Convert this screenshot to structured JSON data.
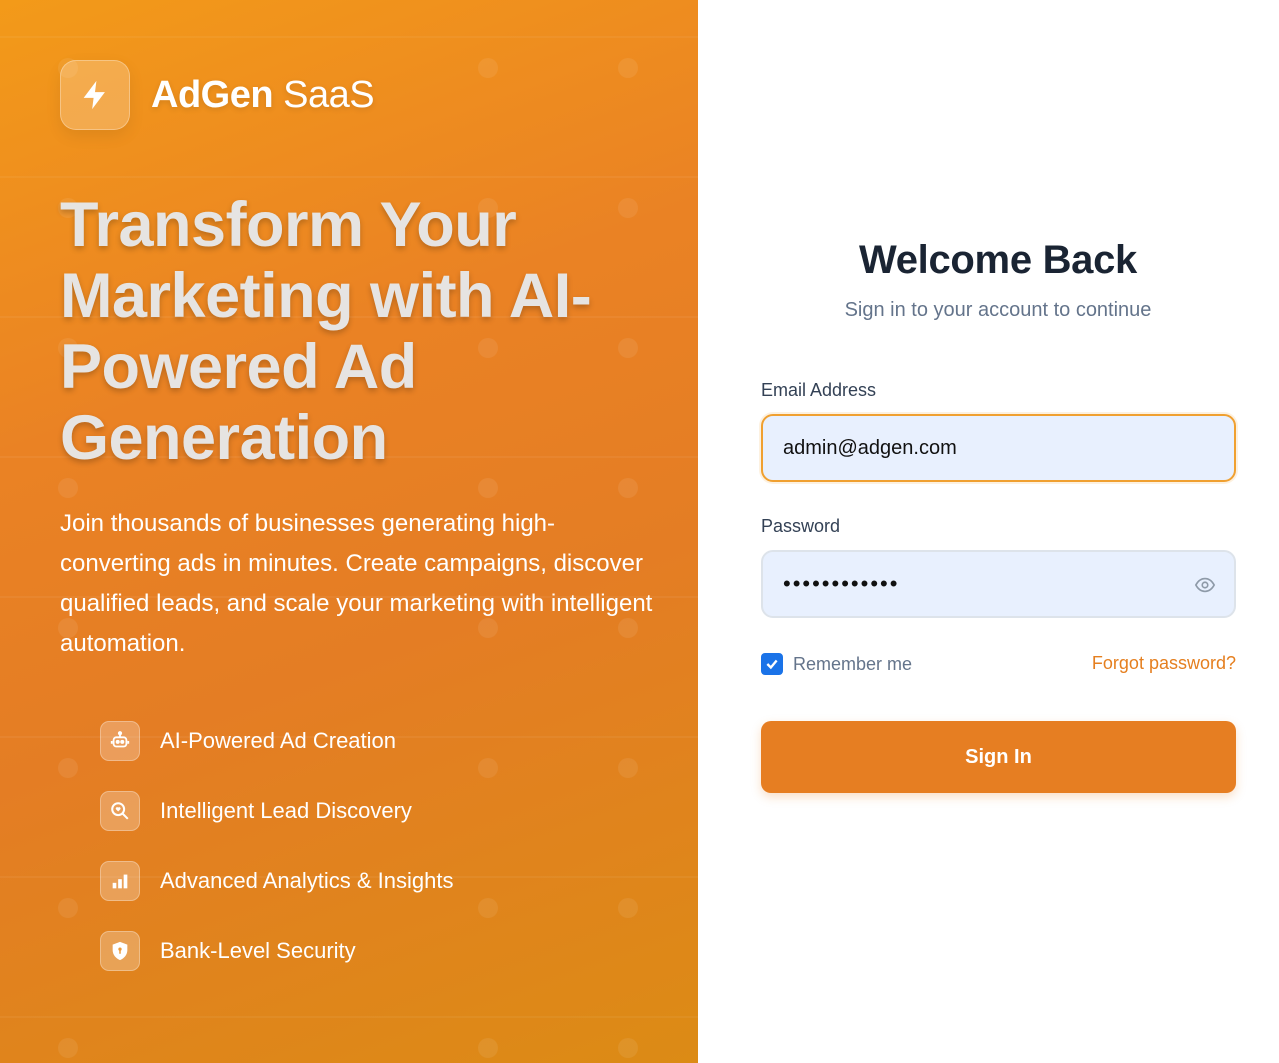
{
  "brand": {
    "name_bold": "AdGen",
    "name_light": "SaaS",
    "icon": "lightning-bolt-icon"
  },
  "hero": {
    "title": "Transform Your Marketing with AI-Powered Ad Generation",
    "description": "Join thousands of businesses generating high-converting ads in minutes. Create campaigns, discover qualified leads, and scale your marketing with intelligent automation."
  },
  "features": [
    {
      "label": "AI-Powered Ad Creation",
      "icon": "robot-icon"
    },
    {
      "label": "Intelligent Lead Discovery",
      "icon": "search-heart-icon"
    },
    {
      "label": "Advanced Analytics & Insights",
      "icon": "bar-chart-icon"
    },
    {
      "label": "Bank-Level Security",
      "icon": "shield-icon"
    }
  ],
  "login": {
    "title": "Welcome Back",
    "subtitle": "Sign in to your account to continue",
    "email_label": "Email Address",
    "email_value": "admin@adgen.com",
    "password_label": "Password",
    "password_value": "••••••••••••",
    "remember_label": "Remember me",
    "remember_checked": true,
    "forgot_label": "Forgot password?",
    "submit_label": "Sign In"
  },
  "colors": {
    "accent": "#e67e22",
    "gradient_start": "#f39a19",
    "gradient_end": "#dc8b15",
    "checkbox": "#1a73e8"
  }
}
